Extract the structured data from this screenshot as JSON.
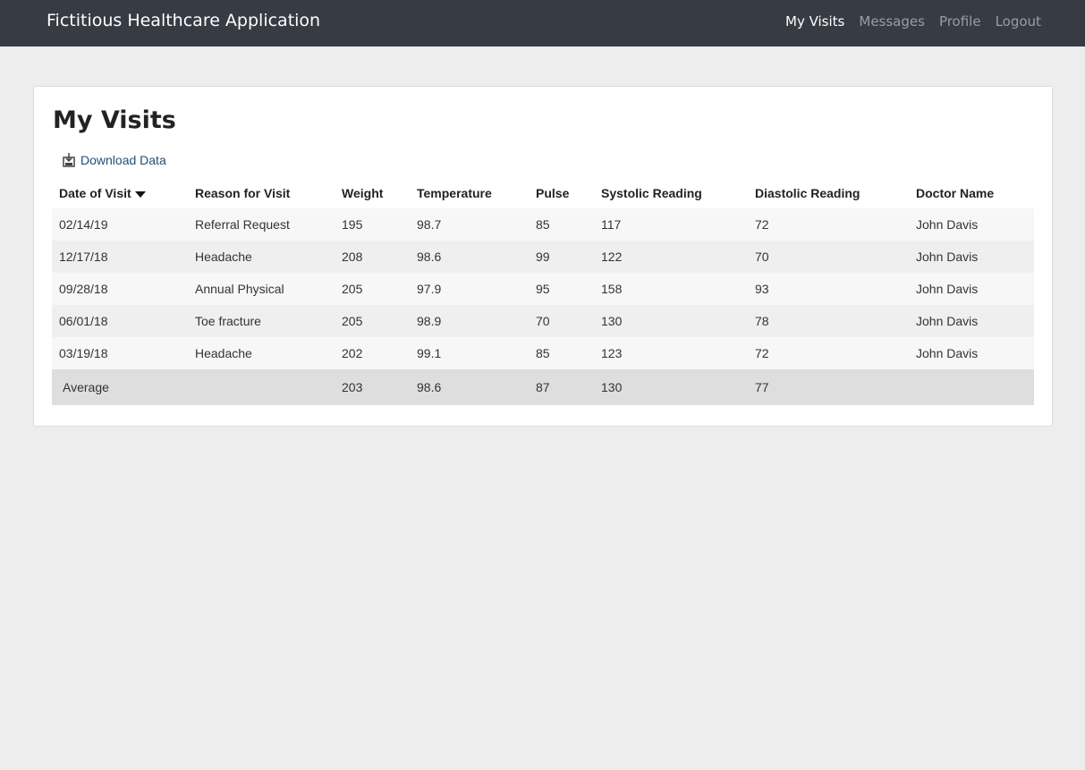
{
  "app": {
    "title": "Fictitious Healthcare Application"
  },
  "nav": {
    "items": [
      {
        "label": "My Visits",
        "active": true
      },
      {
        "label": "Messages",
        "active": false
      },
      {
        "label": "Profile",
        "active": false
      },
      {
        "label": "Logout",
        "active": false
      }
    ]
  },
  "page": {
    "title": "My Visits",
    "download_label": "Download Data",
    "download_icon": "download-icon"
  },
  "table": {
    "sort_icon": "sort-descending-icon",
    "columns": [
      "Date of Visit",
      "Reason for Visit",
      "Weight",
      "Temperature",
      "Pulse",
      "Systolic Reading",
      "Diastolic Reading",
      "Doctor Name"
    ],
    "rows": [
      [
        "02/14/19",
        "Referral Request",
        "195",
        "98.7",
        "85",
        "117",
        "72",
        "John Davis"
      ],
      [
        "12/17/18",
        "Headache",
        "208",
        "98.6",
        "99",
        "122",
        "70",
        "John Davis"
      ],
      [
        "09/28/18",
        "Annual Physical",
        "205",
        "97.9",
        "95",
        "158",
        "93",
        "John Davis"
      ],
      [
        "06/01/18",
        "Toe fracture",
        "205",
        "98.9",
        "70",
        "130",
        "78",
        "John Davis"
      ],
      [
        "03/19/18",
        "Headache",
        "202",
        "99.1",
        "85",
        "123",
        "72",
        "John Davis"
      ]
    ],
    "footer": [
      "Average",
      "",
      "203",
      "98.6",
      "87",
      "130",
      "77",
      ""
    ]
  },
  "colors": {
    "navbar": "#373b43",
    "nav_inactive": "#9a9da2",
    "link": "#1f4e79",
    "page_bg": "#ededed"
  }
}
